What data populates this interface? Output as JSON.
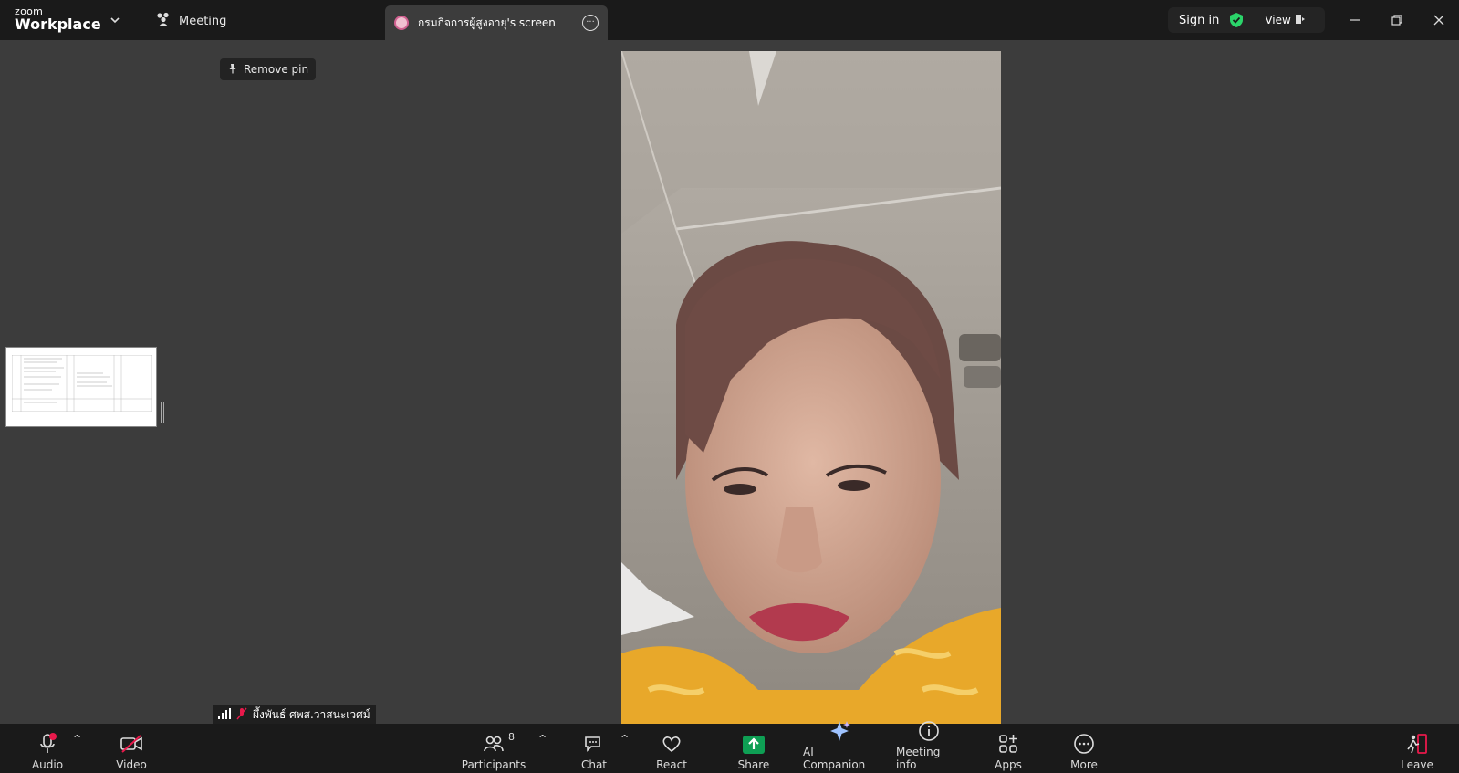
{
  "app": {
    "brand_small": "zoom",
    "brand_large": "Workplace"
  },
  "tabs": {
    "meeting_label": "Meeting",
    "screen_label": "กรมกิจการผู้สูงอายุ's screen"
  },
  "header_right": {
    "signin_label": "Sign in",
    "view_label": "View"
  },
  "stage": {
    "remove_pin_label": "Remove pin",
    "participant_name": "ผึ้งพันธ์ ศพส.วาสนะเวศม์"
  },
  "toolbar": {
    "audio_label": "Audio",
    "video_label": "Video",
    "participants_label": "Participants",
    "participants_count": "8",
    "chat_label": "Chat",
    "react_label": "React",
    "share_label": "Share",
    "ai_label": "AI Companion",
    "info_label": "Meeting info",
    "apps_label": "Apps",
    "more_label": "More",
    "leave_label": "Leave"
  },
  "colors": {
    "share_green": "#0e9f54",
    "shield_green": "#2bd46a",
    "audio_alert": "#e8194b",
    "leave_red": "#e8194b"
  }
}
